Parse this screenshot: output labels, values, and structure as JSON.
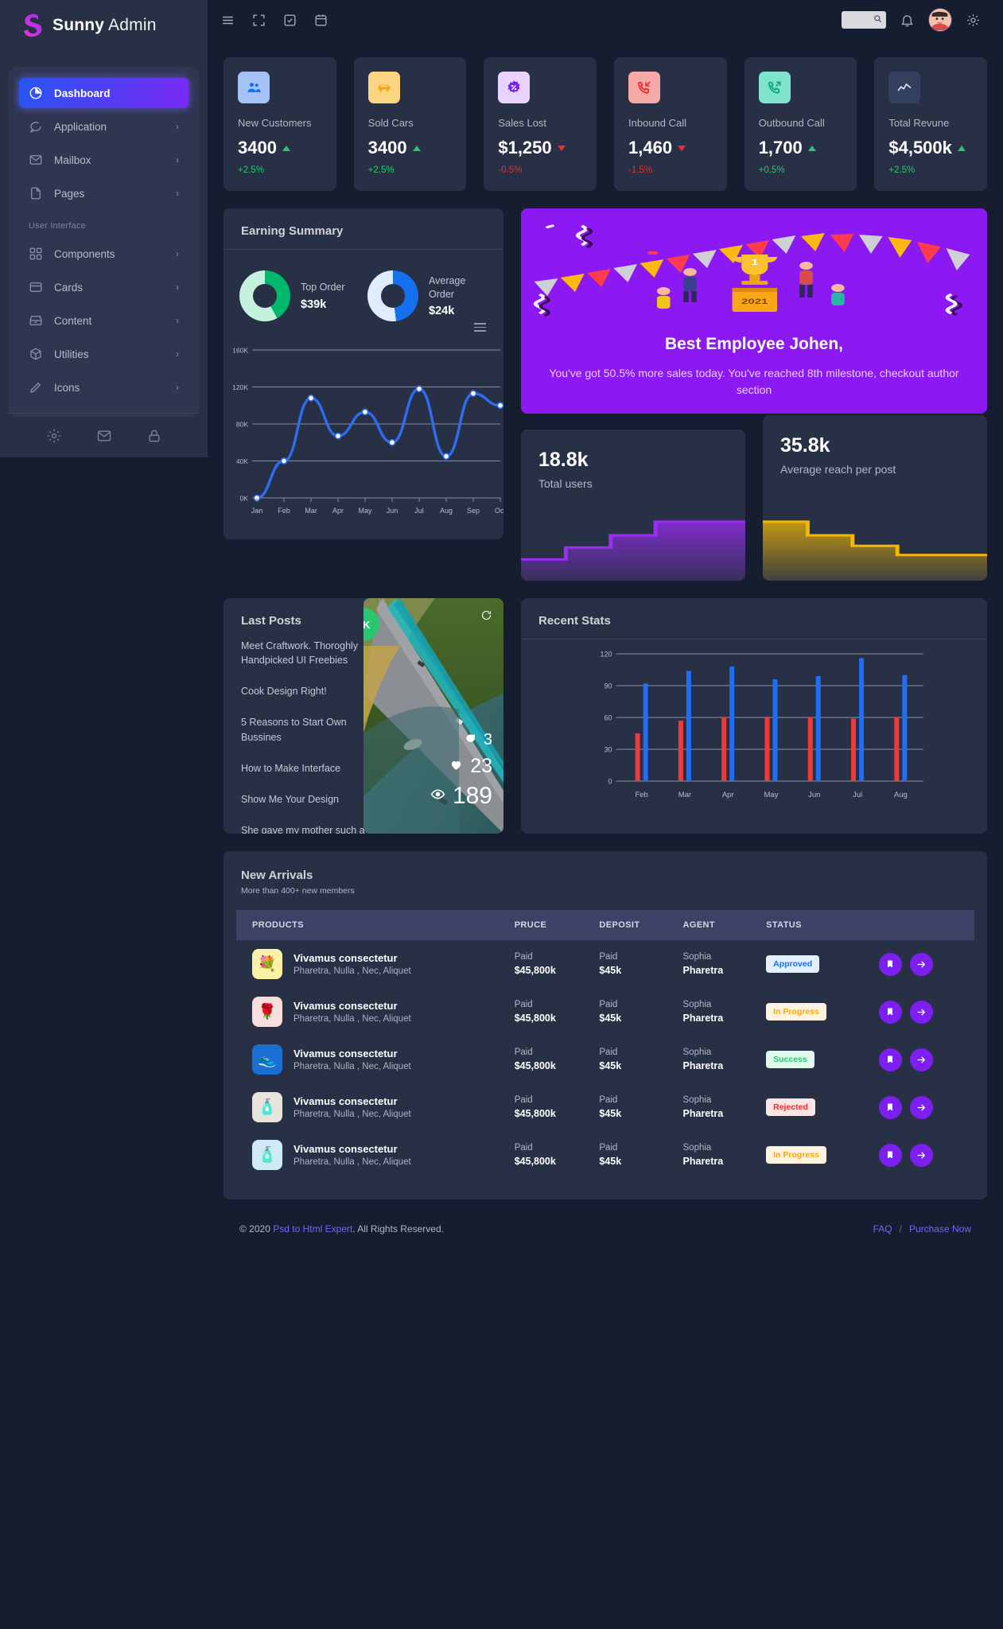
{
  "brand": {
    "logo_icon": "s-logo-icon",
    "name_bold": "Sunny",
    "name_light": " Admin"
  },
  "topbar": {
    "icons": [
      "menu-icon",
      "fullscreen-icon",
      "checklist-icon",
      "calendar-icon"
    ],
    "search_placeholder": "",
    "search_icon": "search-icon",
    "bell_icon": "bell-icon",
    "gear_icon": "gear-icon",
    "avatar_alt": "user-avatar"
  },
  "sidebar": {
    "items": [
      {
        "label": "Dashboard",
        "icon": "pie-chart-icon",
        "active": true,
        "chevron": ""
      },
      {
        "label": "Application",
        "icon": "chat-icon",
        "active": false,
        "chevron": "›"
      },
      {
        "label": "Mailbox",
        "icon": "mail-icon",
        "active": false,
        "chevron": "›"
      },
      {
        "label": "Pages",
        "icon": "file-icon",
        "active": false,
        "chevron": "›"
      }
    ],
    "section_label": "User Interface",
    "items2": [
      {
        "label": "Components",
        "icon": "grid-icon",
        "chevron": "›"
      },
      {
        "label": "Cards",
        "icon": "card-icon",
        "chevron": "›"
      },
      {
        "label": "Content",
        "icon": "drawer-icon",
        "chevron": "›"
      },
      {
        "label": "Utilities",
        "icon": "box-icon",
        "chevron": "›"
      },
      {
        "label": "Icons",
        "icon": "pencil-icon",
        "chevron": "›"
      }
    ],
    "footer_icons": [
      "gear-icon",
      "mail-icon",
      "lock-icon"
    ]
  },
  "stats": [
    {
      "label": "New Customers",
      "value": "3400",
      "delta": "+2.5%",
      "dir": "up",
      "icon": "people-icon",
      "icon_bg": "#a5c2f7",
      "icon_fg": "#1570ef",
      "delta_color": "#28c76f"
    },
    {
      "label": "Sold Cars",
      "value": "3400",
      "delta": "+2.5%",
      "dir": "up",
      "icon": "car-icon",
      "icon_bg": "#fcd581",
      "icon_fg": "#f5a614",
      "delta_color": "#28c76f"
    },
    {
      "label": "Sales Lost",
      "value": "$1,250",
      "delta": "-0.5%",
      "dir": "down",
      "icon": "discount-badge-icon",
      "icon_bg": "#e7d3fb",
      "icon_fg": "#7b1ff0",
      "delta_color": "#ea2d2d"
    },
    {
      "label": "Inbound Call",
      "value": "1,460",
      "delta": "-1.5%",
      "dir": "down",
      "icon": "call-in-icon",
      "icon_bg": "#f6aaa8",
      "icon_fg": "#ea2d2d",
      "delta_color": "#ea2d2d"
    },
    {
      "label": "Outbound Call",
      "value": "1,700",
      "delta": "+0.5%",
      "dir": "up",
      "icon": "call-out-icon",
      "icon_bg": "#7fe3cd",
      "icon_fg": "#0fa37f",
      "delta_color": "#28c76f"
    },
    {
      "label": "Total Revune",
      "value": "$4,500k",
      "delta": "+2.5%",
      "dir": "up",
      "icon": "line-graph-icon",
      "icon_bg": "#33415e",
      "icon_fg": "#e3e6f0",
      "delta_color": "#28c76f"
    }
  ],
  "earning": {
    "title": "Earning Summary",
    "menu_icon": "hamburger-menu-icon",
    "donuts": [
      {
        "label": "Top Order",
        "value": "$39k",
        "color": "#00b86b",
        "track": "#c5f2dc",
        "pct": 42
      },
      {
        "label": "Average Order",
        "value": "$24k",
        "color": "#1570ef",
        "track": "#dfecfd",
        "pct": 48
      }
    ]
  },
  "banner": {
    "title": "Best Employee Johen,",
    "text": "You've got 50.5% more sales today. You've reached 8th milestone, checkout author section",
    "bg": "#8c18f2"
  },
  "mini_cards": [
    {
      "number": "18.8k",
      "label": "Total users",
      "accent": "#9b2df5",
      "steps": [
        28,
        44,
        60,
        78,
        78
      ]
    },
    {
      "number": "35.8k",
      "label": "Average reach per post",
      "accent": "#f5b800",
      "steps": [
        78,
        60,
        46,
        34,
        34
      ]
    }
  ],
  "posts": {
    "title": "Last Posts",
    "badge": "DK",
    "refresh_icon": "refresh-icon",
    "items": [
      "Meet Craftwork. Thoroghly Handpicked UI Freebies",
      "Cook Design Right!",
      "5 Reasons to Start Own Bussines",
      "How to Make Interface",
      "Show Me Your Design",
      "She gave my mother such a turn, that I have always bee..."
    ],
    "metrics": [
      {
        "icon": "comment-icon",
        "value": "3",
        "size": 20
      },
      {
        "icon": "heart-icon",
        "value": "23",
        "size": 25
      },
      {
        "icon": "eye-icon",
        "value": "189",
        "size": 30
      }
    ]
  },
  "recent_stats": {
    "title": "Recent Stats",
    "menu_icon": "hamburger-menu-icon"
  },
  "arrivals": {
    "title": "New Arrivals",
    "subtitle": "More than 400+ new members",
    "columns": [
      "PRODUCTS",
      "PRUCE",
      "DEPOSIT",
      "AGENT",
      "STATUS",
      ""
    ],
    "rows": [
      {
        "name": "Vivamus consectetur",
        "desc": "Pharetra, Nulla , Nec, Aliquet",
        "price_top": "Paid",
        "price_bot": "$45,800k",
        "dep_top": "Paid",
        "dep_bot": "$45k",
        "agent_top": "Sophia",
        "agent_bot": "Pharetra",
        "status": "Approved",
        "status_color": "#1570ef",
        "status_bg": "#e4efff",
        "img": "bouquet-icon",
        "img_bg": "#fbf0a5",
        "emoji": "💐"
      },
      {
        "name": "Vivamus consectetur",
        "desc": "Pharetra, Nulla , Nec, Aliquet",
        "price_top": "Paid",
        "price_bot": "$45,800k",
        "dep_top": "Paid",
        "dep_bot": "$45k",
        "agent_top": "Sophia",
        "agent_bot": "Pharetra",
        "status": "In Progress",
        "status_color": "#f5a614",
        "status_bg": "#fdf3e0",
        "img": "rose-icon",
        "img_bg": "#f7dedd",
        "emoji": "🌹"
      },
      {
        "name": "Vivamus consectetur",
        "desc": "Pharetra, Nulla , Nec, Aliquet",
        "price_top": "Paid",
        "price_bot": "$45,800k",
        "dep_top": "Paid",
        "dep_bot": "$45k",
        "agent_top": "Sophia",
        "agent_bot": "Pharetra",
        "status": "Success",
        "status_color": "#28c76f",
        "status_bg": "#e1f8ec",
        "img": "shoe-icon",
        "img_bg": "#1a6fd4",
        "emoji": "👟"
      },
      {
        "name": "Vivamus consectetur",
        "desc": "Pharetra, Nulla , Nec, Aliquet",
        "price_top": "Paid",
        "price_bot": "$45,800k",
        "dep_top": "Paid",
        "dep_bot": "$45k",
        "agent_top": "Sophia",
        "agent_bot": "Pharetra",
        "status": "Rejected",
        "status_color": "#ea2d2d",
        "status_bg": "#fce5e5",
        "img": "cream-icon",
        "img_bg": "#e8e3dd",
        "emoji": "🧴"
      },
      {
        "name": "Vivamus consectetur",
        "desc": "Pharetra, Nulla , Nec, Aliquet",
        "price_top": "Paid",
        "price_bot": "$45,800k",
        "dep_top": "Paid",
        "dep_bot": "$45k",
        "agent_top": "Sophia",
        "agent_bot": "Pharetra",
        "status": "In Progress",
        "status_color": "#f5a614",
        "status_bg": "#fdf3e0",
        "img": "perfume-icon",
        "img_bg": "#cfeaf5",
        "emoji": "🧴"
      }
    ],
    "action_icons": [
      "bookmark-icon",
      "arrow-right-icon"
    ]
  },
  "footer": {
    "copyright": "© 2020",
    "link": "Psd to Html Expert",
    "rights": ". All Rights Reserved.",
    "faq": "FAQ",
    "sep": "/",
    "purchase": "Purchase Now"
  },
  "chart_data": [
    {
      "type": "line",
      "title": "Earning Summary",
      "x": [
        "Jan",
        "Feb",
        "Mar",
        "Apr",
        "May",
        "Jun",
        "Jul",
        "Aug",
        "Sep",
        "Oct"
      ],
      "values": [
        0,
        40,
        108,
        67,
        93,
        60,
        118,
        45,
        113,
        100
      ],
      "ylabel": "",
      "xlabel": "",
      "yticks": [
        "0K",
        "40K",
        "80K",
        "120K",
        "160K"
      ],
      "ylim": [
        0,
        160
      ],
      "grid": true,
      "line_color": "#2f6cf0",
      "point_color": "#ffffff"
    },
    {
      "type": "bar",
      "title": "Recent Stats",
      "categories": [
        "Feb",
        "Mar",
        "Apr",
        "May",
        "Jun",
        "Jul",
        "Aug"
      ],
      "series": [
        {
          "name": "series-blue",
          "color": "#1f6ef5",
          "values": [
            92,
            104,
            108,
            96,
            99,
            116,
            100
          ]
        },
        {
          "name": "series-red",
          "color": "#f03a3a",
          "values": [
            45,
            57,
            60,
            60,
            60,
            59,
            60
          ]
        }
      ],
      "yticks": [
        "0",
        "30",
        "60",
        "90",
        "120"
      ],
      "ylim": [
        0,
        120
      ],
      "grid": true
    },
    {
      "type": "area",
      "title": "Total users",
      "values": [
        28,
        44,
        60,
        78,
        78
      ],
      "accent": "#9b2df5"
    },
    {
      "type": "area",
      "title": "Average reach per post",
      "values": [
        78,
        60,
        46,
        34,
        34
      ],
      "accent": "#f5b800"
    },
    {
      "type": "pie",
      "title": "Top Order",
      "labels": [
        "completed",
        "remaining"
      ],
      "values": [
        42,
        58
      ],
      "colors": [
        "#00b86b",
        "#c5f2dc"
      ]
    },
    {
      "type": "pie",
      "title": "Average Order",
      "labels": [
        "completed",
        "remaining"
      ],
      "values": [
        48,
        52
      ],
      "colors": [
        "#1570ef",
        "#dfecfd"
      ]
    }
  ]
}
